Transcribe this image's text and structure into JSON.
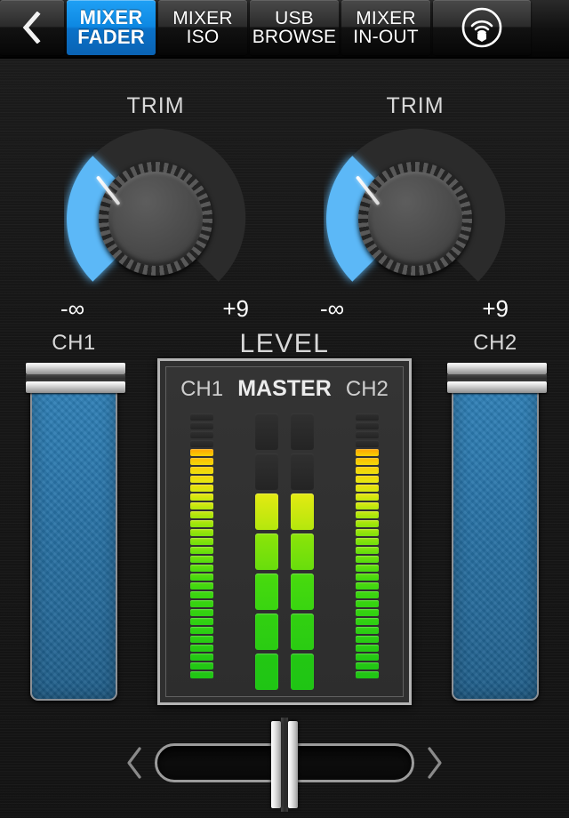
{
  "topbar": {
    "back_icon": "chevron-left-icon",
    "tabs": [
      {
        "id": "mixer-fader",
        "line1": "MIXER",
        "line2": "FADER",
        "active": true
      },
      {
        "id": "mixer-iso",
        "line1": "MIXER",
        "line2": "ISO",
        "active": false
      },
      {
        "id": "usb-browse",
        "line1": "USB",
        "line2": "BROWSE",
        "active": false
      },
      {
        "id": "mixer-in-out",
        "line1": "MIXER",
        "line2": "IN-OUT",
        "active": false
      }
    ],
    "wireless_icon": "wireless-signal-icon",
    "active_color": "#0d88e2"
  },
  "trim": {
    "left": {
      "label": "TRIM",
      "min": "-∞",
      "max": "+9",
      "arc_color": "#55b4f5",
      "angle_deg": -38
    },
    "right": {
      "label": "TRIM",
      "min": "-∞",
      "max": "+9",
      "arc_color": "#55b4f5",
      "angle_deg": -38
    }
  },
  "faders": {
    "ch1": {
      "label": "CH1",
      "handle_top_pct": 0,
      "fill_color": "#2a76ab"
    },
    "ch2": {
      "label": "CH2",
      "handle_top_pct": 0,
      "fill_color": "#2a76ab"
    }
  },
  "level": {
    "title": "LEVEL",
    "headers": {
      "ch1": "CH1",
      "master": "MASTER",
      "ch2": "CH2"
    }
  },
  "crossfader": {
    "left_icon": "chevron-left-icon",
    "right_icon": "chevron-right-icon",
    "position_pct": 50
  },
  "chart_data": {
    "type": "bar",
    "title": "LEVEL",
    "orientation": "vertical-segmented-meters",
    "categories": [
      "CH1",
      "MASTER-L",
      "MASTER-R",
      "CH2"
    ],
    "values": [
      26,
      5,
      5,
      26
    ],
    "series": [
      {
        "name": "CH1",
        "lit_segments": 26,
        "total_segments": 30,
        "segment_style": "fine"
      },
      {
        "name": "MASTER-L",
        "lit_segments": 5,
        "total_segments": 7,
        "segment_style": "coarse"
      },
      {
        "name": "MASTER-R",
        "lit_segments": 5,
        "total_segments": 7,
        "segment_style": "coarse"
      },
      {
        "name": "CH2",
        "lit_segments": 26,
        "total_segments": 30,
        "segment_style": "fine"
      }
    ],
    "color_scale": [
      {
        "stop": 0.0,
        "color": "#1fc514"
      },
      {
        "stop": 0.35,
        "color": "#3ed80f"
      },
      {
        "stop": 0.55,
        "color": "#8ee40a"
      },
      {
        "stop": 0.72,
        "color": "#e8ea12"
      },
      {
        "stop": 0.86,
        "color": "#ffc400"
      },
      {
        "stop": 1.0,
        "color": "#ff5f00"
      }
    ],
    "xlabel": "",
    "ylabel": "Level",
    "grid": false,
    "legend": "none"
  }
}
